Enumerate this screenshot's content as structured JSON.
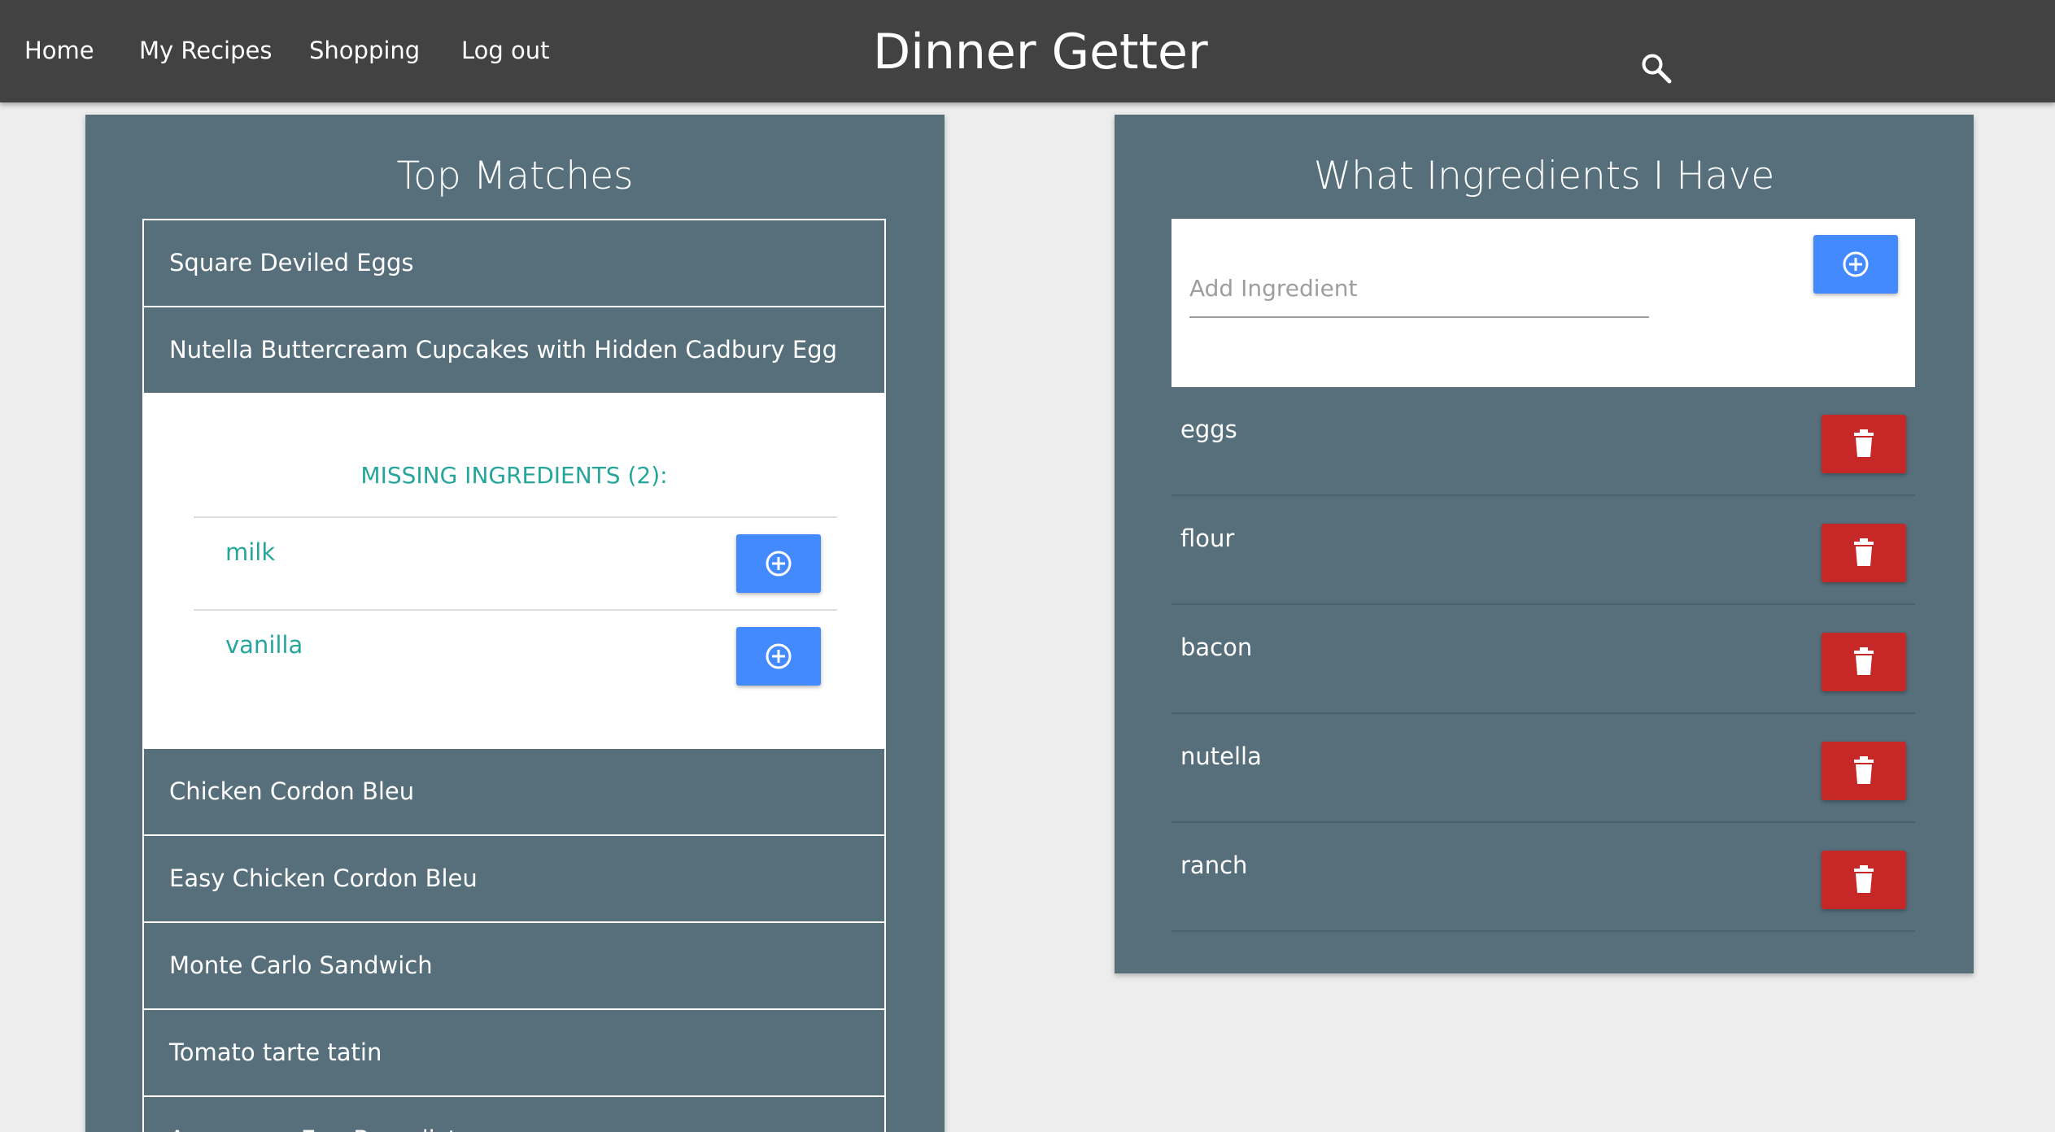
{
  "nav": {
    "links": [
      "Home",
      "My Recipes",
      "Shopping",
      "Log out"
    ],
    "brand": "Dinner Getter",
    "search_icon": "search-icon"
  },
  "top_matches": {
    "title": "Top Matches",
    "recipes": [
      "Square Deviled Eggs",
      "Nutella Buttercream Cupcakes with Hidden Cadbury Egg",
      "Chicken Cordon Bleu",
      "Easy Chicken Cordon Bleu",
      "Monte Carlo Sandwich",
      "Tomato tarte tatin",
      "Asparagus Egg Benedict"
    ],
    "expanded": {
      "missing_label": "MISSING INGREDIENTS (2):",
      "missing": [
        "milk",
        "vanilla"
      ],
      "add_icon": "plus-circle-icon"
    }
  },
  "ingredients": {
    "title": "What Ingredients I Have",
    "input_placeholder": "Add Ingredient",
    "input_value": "",
    "add_icon": "plus-circle-icon",
    "delete_icon": "trash-icon",
    "items": [
      "eggs",
      "flour",
      "bacon",
      "nutella",
      "ranch"
    ]
  },
  "colors": {
    "navbar": "#424242",
    "panel": "#566f7b",
    "accent_teal": "#26a69a",
    "add_blue": "#448aff",
    "delete_red": "#c62828",
    "background": "#ededed"
  }
}
